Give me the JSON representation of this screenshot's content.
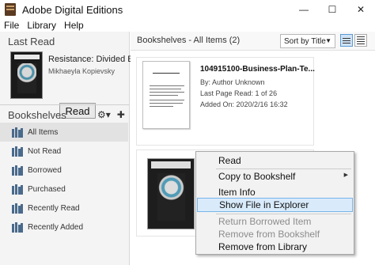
{
  "window": {
    "title": "Adobe Digital Editions",
    "controls": {
      "minimize": "—",
      "maximize": "☐",
      "close": "✕"
    }
  },
  "menubar": {
    "items": [
      "File",
      "Library",
      "Help"
    ]
  },
  "sidebar": {
    "last_read_heading": "Last Read",
    "last_read_book": {
      "title": "Resistance: Divided El...",
      "author": "Mikhaeyla Kopievsky"
    },
    "read_button": "Read",
    "bookshelves_heading": "Bookshelves",
    "tool_icons": [
      "gear-icon",
      "plus-icon"
    ],
    "shelves": [
      {
        "label": "All Items",
        "selected": true
      },
      {
        "label": "Not Read",
        "selected": false
      },
      {
        "label": "Borrowed",
        "selected": false
      },
      {
        "label": "Purchased",
        "selected": false
      },
      {
        "label": "Recently Read",
        "selected": false
      },
      {
        "label": "Recently Added",
        "selected": false
      }
    ]
  },
  "main": {
    "header_title": "Bookshelves - All Items (2)",
    "sort_label": "Sort by Title",
    "items": [
      {
        "title": "104915100-Business-Plan-Te...",
        "author_line": "By:  Author Unknown",
        "last_page_line": "Last Page Read:  1 of 26",
        "added_line": "Added On:  2020/2/16 16:32"
      }
    ]
  },
  "context_menu": {
    "items": [
      {
        "label": "Read",
        "disabled": false,
        "submenu": false
      },
      {
        "label": "Copy to Bookshelf",
        "disabled": false,
        "submenu": true
      },
      {
        "label": "Item Info",
        "disabled": false,
        "submenu": false
      },
      {
        "label": "Show File in Explorer",
        "disabled": false,
        "submenu": false,
        "highlighted": true
      },
      {
        "label": "Return Borrowed Item",
        "disabled": true,
        "submenu": false
      },
      {
        "label": "Remove from Bookshelf",
        "disabled": true,
        "submenu": false
      },
      {
        "label": "Remove from Library",
        "disabled": false,
        "submenu": false
      }
    ]
  },
  "colors": {
    "selection_highlight": "#d9ebfb",
    "selection_border": "#79b4ea",
    "shelf_icon": "#4a6a8c"
  }
}
